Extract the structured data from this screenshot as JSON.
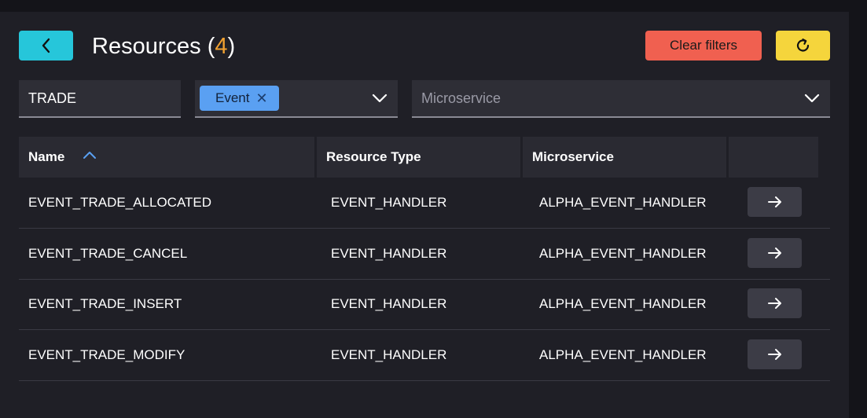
{
  "header": {
    "back_icon": "chevron-left-icon",
    "title": "Resources",
    "count_open": "(",
    "count": "4",
    "count_close": ")",
    "clear_label": "Clear filters",
    "refresh_icon": "refresh-icon"
  },
  "filters": {
    "search_value": "TRADE",
    "type_chip": "Event",
    "type_chip_remove": "✕",
    "microservice_placeholder": "Microservice"
  },
  "table": {
    "columns": [
      "Name",
      "Resource Type",
      "Microservice"
    ],
    "sort_column": "Name",
    "sort_direction": "ascending",
    "rows": [
      {
        "name": "EVENT_TRADE_ALLOCATED",
        "type": "EVENT_HANDLER",
        "microservice": "ALPHA_EVENT_HANDLER"
      },
      {
        "name": "EVENT_TRADE_CANCEL",
        "type": "EVENT_HANDLER",
        "microservice": "ALPHA_EVENT_HANDLER"
      },
      {
        "name": "EVENT_TRADE_INSERT",
        "type": "EVENT_HANDLER",
        "microservice": "ALPHA_EVENT_HANDLER"
      },
      {
        "name": "EVENT_TRADE_MODIFY",
        "type": "EVENT_HANDLER",
        "microservice": "ALPHA_EVENT_HANDLER"
      }
    ]
  },
  "colors": {
    "back": "#26c6da",
    "clear": "#f06050",
    "refresh": "#f5d53c",
    "count": "#f0a030",
    "chip": "#5aa0f2"
  }
}
